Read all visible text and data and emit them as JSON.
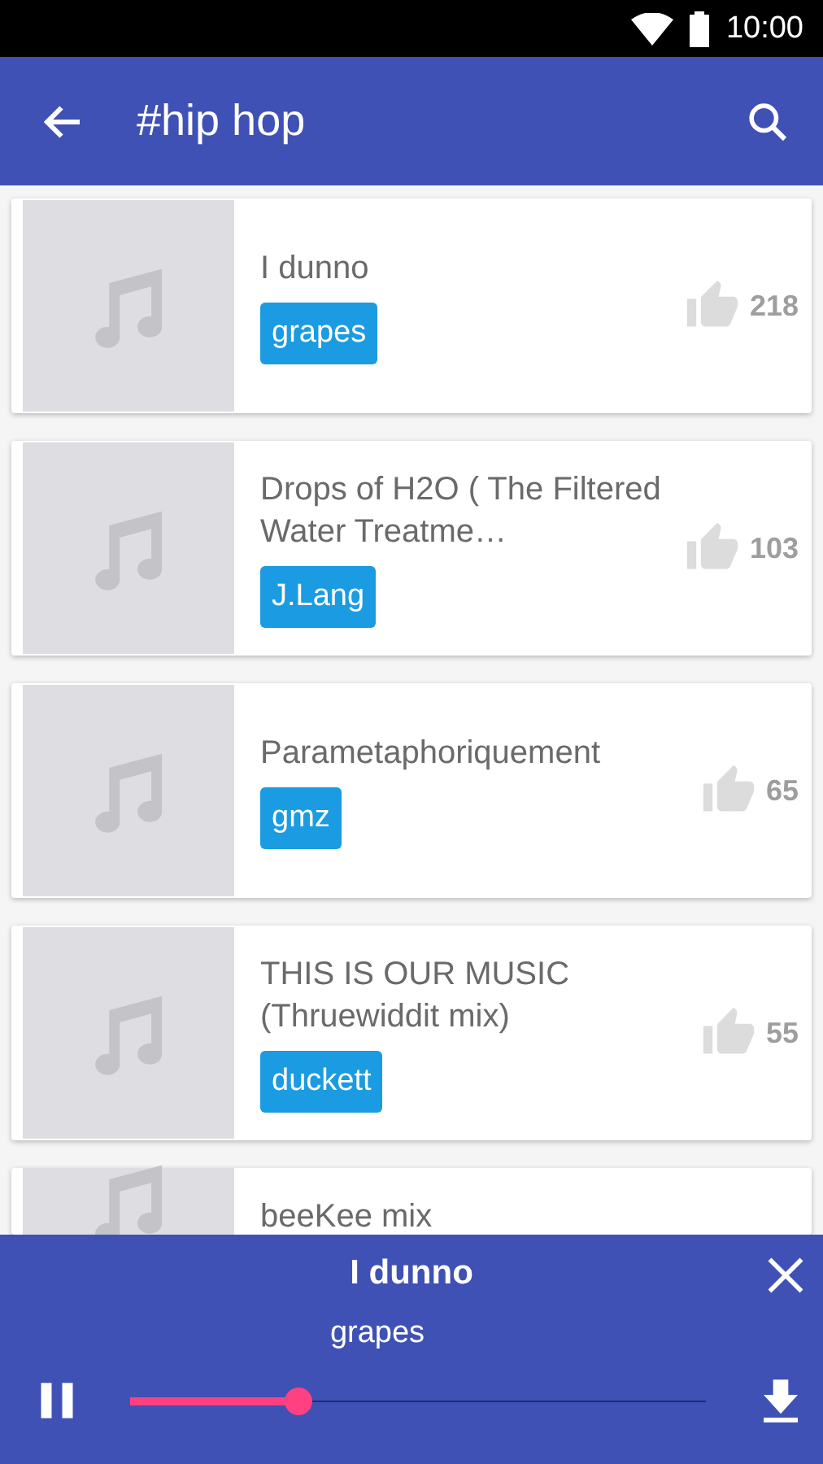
{
  "status_bar": {
    "time": "10:00"
  },
  "app_bar": {
    "title": "#hip hop"
  },
  "tracks": [
    {
      "title": "I dunno",
      "artist": "grapes",
      "likes": "218"
    },
    {
      "title": "Drops of H2O ( The Filtered Water Treatme…",
      "artist": "J.Lang",
      "likes": "103"
    },
    {
      "title": "Parametaphoriquement",
      "artist": "gmz",
      "likes": "65"
    },
    {
      "title": "THIS IS OUR MUSIC (Thruewiddit mix)",
      "artist": "duckett",
      "likes": "55"
    },
    {
      "title": "beeKee mix"
    }
  ],
  "player": {
    "title": "I dunno",
    "artist": "grapes",
    "playing": true,
    "level": 0.29
  }
}
